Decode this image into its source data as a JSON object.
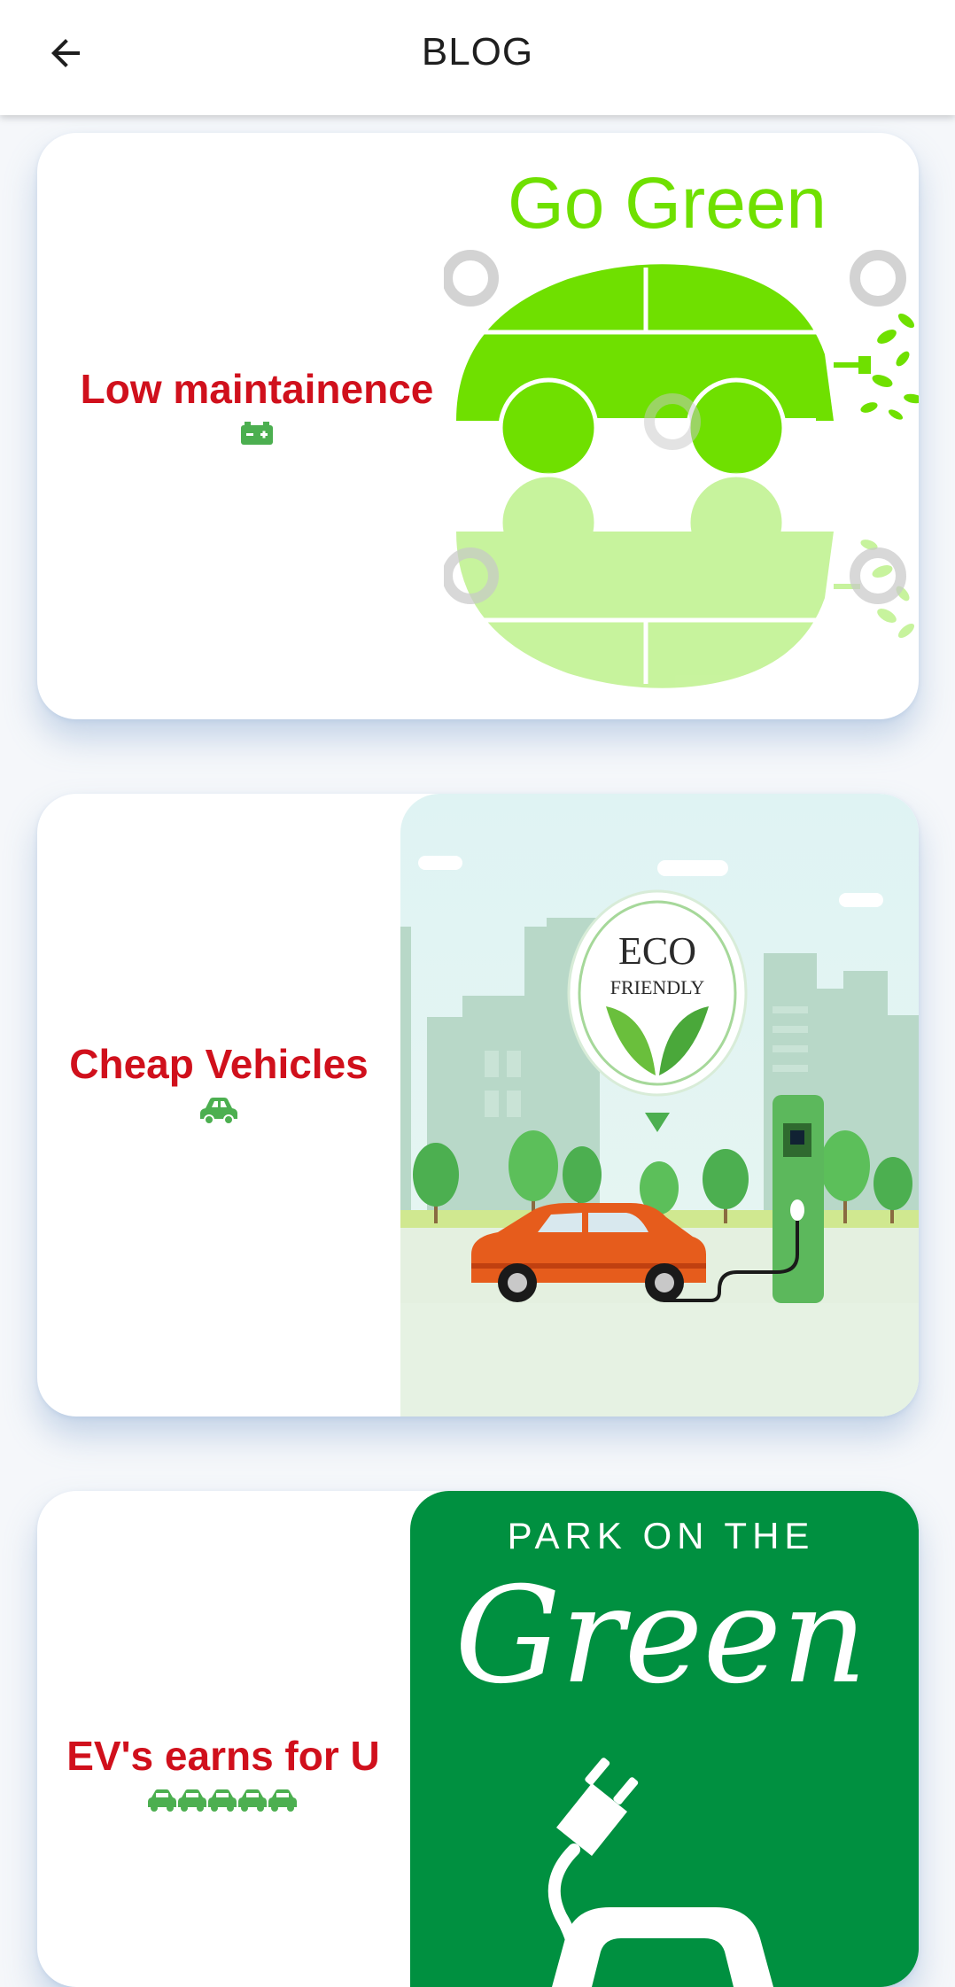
{
  "appbar": {
    "title": "BLOG",
    "back_icon": "arrow-left-icon"
  },
  "cards": [
    {
      "title": "Low maintainence",
      "icon": "battery-icon",
      "image": {
        "type": "illustration",
        "heading": "Go Green"
      }
    },
    {
      "title": "Cheap Vehicles",
      "icon": "car-icon",
      "image": {
        "type": "illustration",
        "badge_line1": "ECO",
        "badge_line2": "FRIENDLY"
      }
    },
    {
      "title": "EV's earns for U",
      "icon": "cars-row-icon",
      "image": {
        "type": "illustration",
        "line1": "PARK ON THE",
        "line2": "Green"
      }
    }
  ],
  "colors": {
    "title_red": "#d0101c",
    "icon_green": "#4caf50",
    "eco_green": "#009040",
    "lime": "#6fe000"
  }
}
